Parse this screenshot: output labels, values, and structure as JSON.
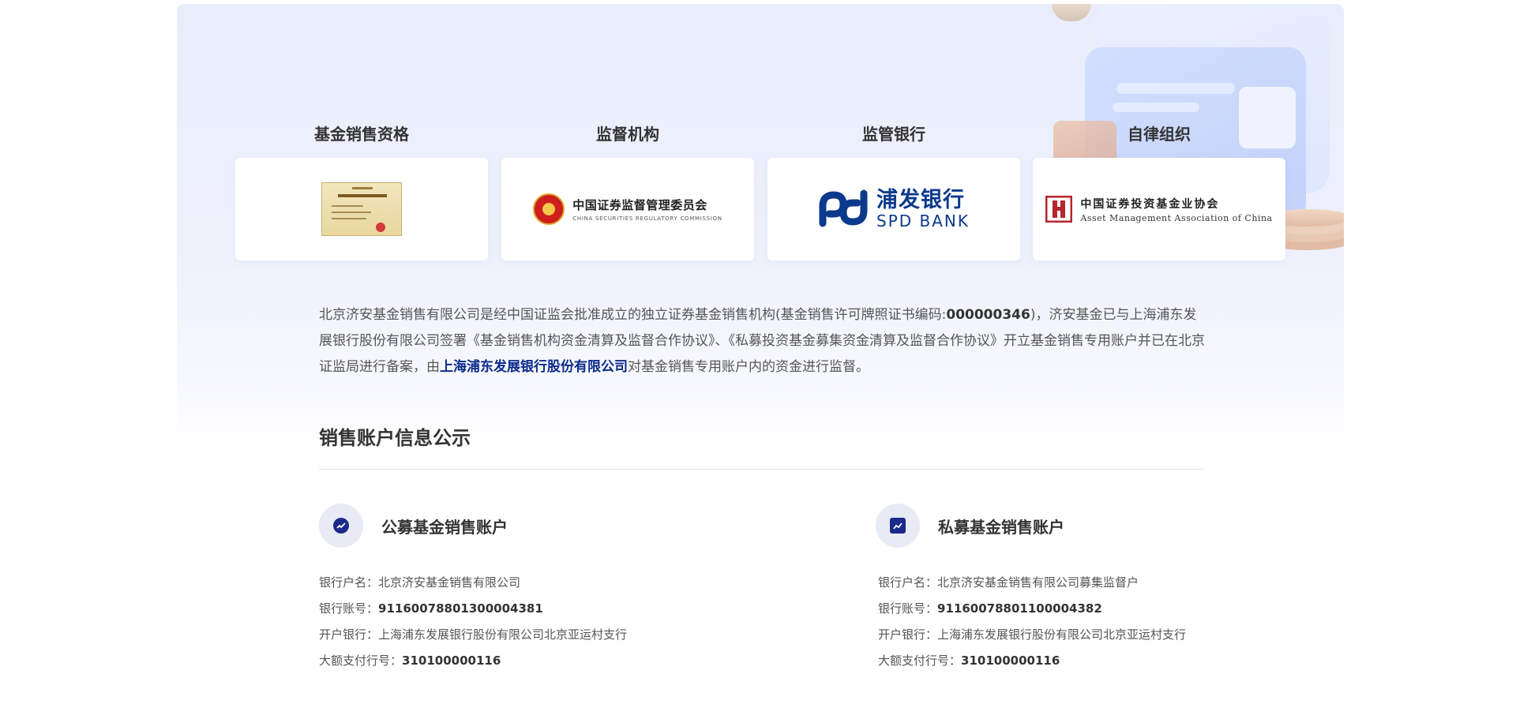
{
  "columns": [
    {
      "title": "基金销售资格",
      "logo": "fund-sales-license-certificate"
    },
    {
      "title": "监督机构",
      "logo": "csrc-logo",
      "logo_cn": "中国证券监督管理委员会",
      "logo_en": "CHINA SECURITIES REGULATORY COMMISSION"
    },
    {
      "title": "监管银行",
      "logo": "spdb-logo",
      "logo_cn": "浦发银行",
      "logo_en": "SPD BANK"
    },
    {
      "title": "自律组织",
      "logo": "amac-logo",
      "logo_cn": "中国证券投资基金业协会",
      "logo_en": "Asset Management Association of China"
    }
  ],
  "intro": {
    "part1": "北京济安基金销售有限公司是经中国证监会批准成立的独立证券基金销售机构(基金销售许可牌照证书编码:",
    "license_no": "000000346",
    "part2": ")，济安基金已与上海浦东发展银行股份有限公司签署《基金销售机构资金清算及监督合作协议》、《私募投资基金募集资金清算及监督合作协议》开立基金销售专用账户并已在北京证监局进行备案，由",
    "bank_highlight": "上海浦东发展银行股份有限公司",
    "part3": "对基金销售专用账户内的资金进行监督。"
  },
  "section_title": "销售账户信息公示",
  "accounts": [
    {
      "title": "公募基金销售账户",
      "icon": "trend-chart-icon",
      "name_label": "银行户名：",
      "name_value": "北京济安基金销售有限公司",
      "number_label": "银行账号：",
      "number_value": "91160078801300004381",
      "branch_label": "开户银行：",
      "branch_value": "上海浦东发展银行股份有限公司北京亚运村支行",
      "payment_label": "大额支付行号：",
      "payment_value": "310100000116"
    },
    {
      "title": "私募基金销售账户",
      "icon": "growth-chart-icon",
      "name_label": "银行户名：",
      "name_value": "北京济安基金销售有限公司募集监督户",
      "number_label": "银行账号：",
      "number_value": "91160078801100004382",
      "branch_label": "开户银行：",
      "branch_value": "上海浦东发展银行股份有限公司北京亚运村支行",
      "payment_label": "大额支付行号：",
      "payment_value": "310100000116"
    }
  ],
  "colors": {
    "accent": "#1b2a8a",
    "bank_blue": "#0b3a8d",
    "hero_bg": "#e9edfb"
  }
}
